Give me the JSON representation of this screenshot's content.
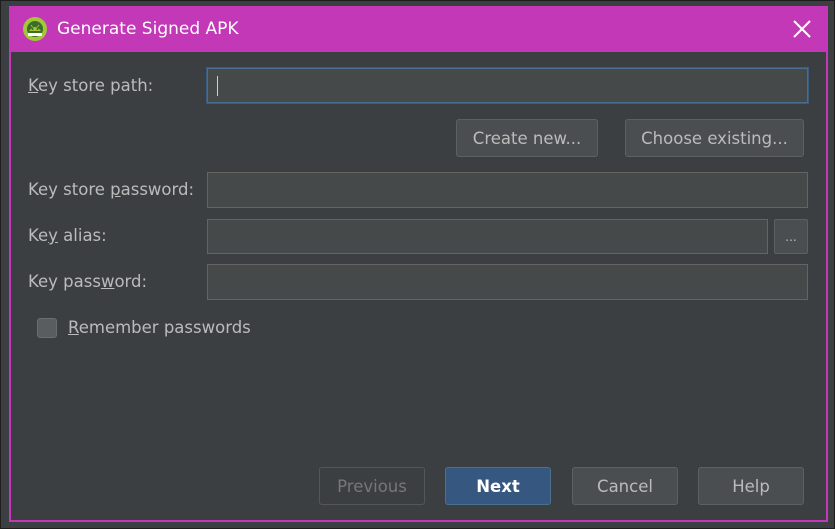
{
  "window": {
    "title": "Generate Signed APK",
    "accent_color": "#c238b6",
    "icon": "android-studio-icon"
  },
  "form": {
    "key_store_path": {
      "label_pre": "",
      "label_u": "K",
      "label_post": "ey store path:",
      "value": ""
    },
    "create_new_label": "Create new...",
    "choose_existing_label": "Choose existing...",
    "key_store_password": {
      "label_pre": "Key store ",
      "label_u": "p",
      "label_post": "assword:",
      "value": ""
    },
    "key_alias": {
      "label_pre": "Ke",
      "label_u": "y",
      "label_post": " alias:",
      "value": "",
      "browse_label": "..."
    },
    "key_password": {
      "label_pre": "Key pass",
      "label_u": "w",
      "label_post": "ord:",
      "value": ""
    },
    "remember_passwords": {
      "label_u": "R",
      "label_post": "emember passwords",
      "checked": false
    }
  },
  "footer": {
    "previous_label": "Previous",
    "next_label": "Next",
    "cancel_label": "Cancel",
    "help_label": "Help"
  }
}
